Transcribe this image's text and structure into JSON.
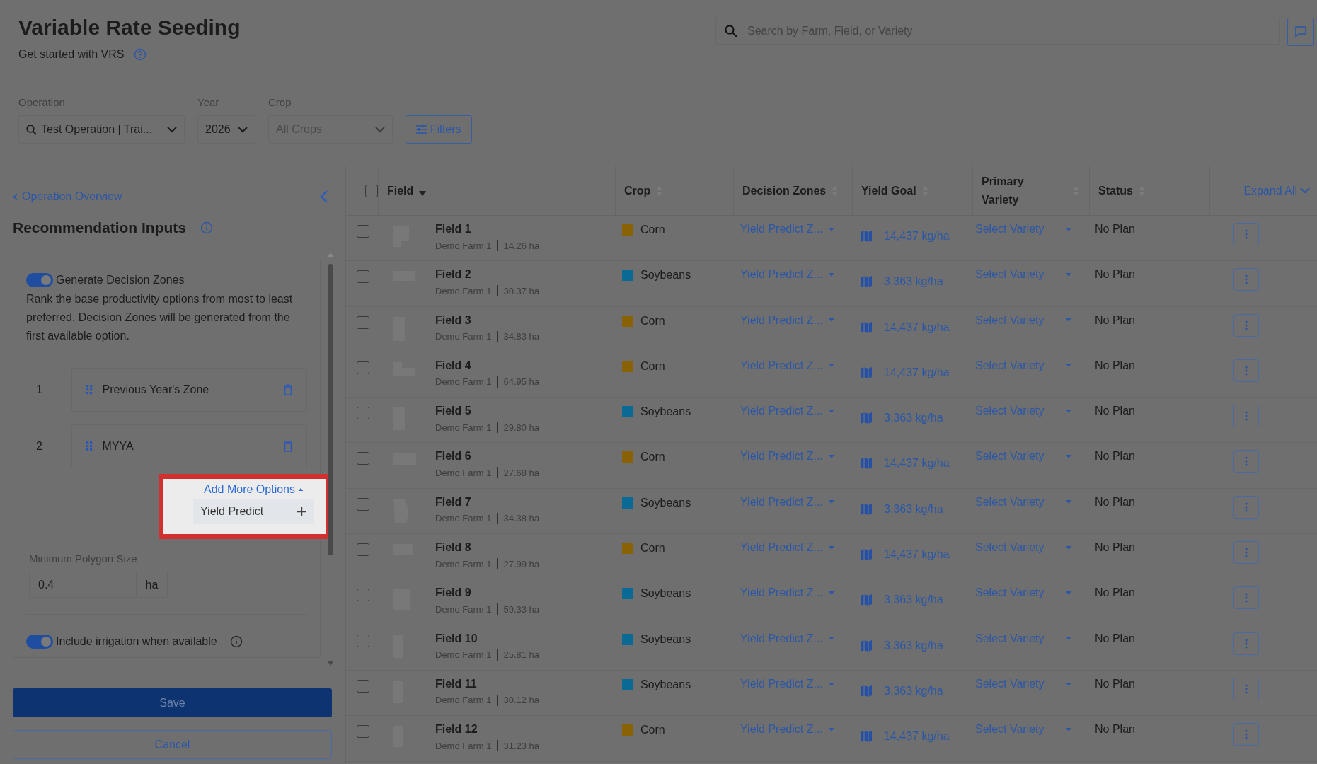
{
  "header": {
    "title": "Variable Rate Seeding",
    "help_link": "Get started with VRS"
  },
  "search": {
    "placeholder": "Search by Farm, Field, or Variety"
  },
  "filters": [
    {
      "label": "Operation",
      "value": "Test Operation | Trai...",
      "kind": "search-select",
      "placeholder": false
    },
    {
      "label": "Year",
      "value": "2026",
      "kind": "select",
      "placeholder": false
    },
    {
      "label": "Crop",
      "value": "All Crops",
      "kind": "select",
      "placeholder": true
    }
  ],
  "filters_button": "Filters",
  "sidebar": {
    "back_link": "Operation Overview",
    "heading": "Recommendation Inputs",
    "generate_zones": {
      "label": "Generate Decision Zones",
      "on": true,
      "description": "Rank the base productivity options from most to least preferred. Decision Zones will be generated from the first available option."
    },
    "options": [
      {
        "rank": "1",
        "name": "Previous Year's Zone"
      },
      {
        "rank": "2",
        "name": "MYYA"
      }
    ],
    "add_more": {
      "label": "Add More Options",
      "expanded": true,
      "items": [
        "Yield Predict"
      ]
    },
    "min_polygon": {
      "label": "Minimum Polygon Size",
      "value": "0.4",
      "unit": "ha"
    },
    "irrigation": {
      "label": "Include irrigation when available",
      "on": true
    },
    "save": "Save",
    "cancel": "Cancel"
  },
  "table": {
    "all_checked": false,
    "columns": [
      {
        "label": "Field",
        "sorted": true
      },
      {
        "label": "Crop",
        "sorted": false
      },
      {
        "label": "Decision Zones",
        "sorted": false
      },
      {
        "label": "Yield Goal",
        "sorted": false
      },
      {
        "label": "Primary Variety",
        "sorted": false
      },
      {
        "label": "Status",
        "sorted": false
      }
    ],
    "expand_all": "Expand All",
    "rows": [
      {
        "field": "Field 1",
        "farm": "Demo Farm 1",
        "area": "14.26 ha",
        "crop": "Corn",
        "color": "#8a6206",
        "zones": "Yield Predict Z...",
        "yield_goal": "14,437 kg/ha",
        "variety": "Select Variety",
        "status": "No Plan",
        "checked": false
      },
      {
        "field": "Field 2",
        "farm": "Demo Farm 1",
        "area": "30.37 ha",
        "crop": "Soybeans",
        "color": "#0a6a95",
        "zones": "Yield Predict Z...",
        "yield_goal": "3,363 kg/ha",
        "variety": "Select Variety",
        "status": "No Plan",
        "checked": false
      },
      {
        "field": "Field 3",
        "farm": "Demo Farm 1",
        "area": "34.83 ha",
        "crop": "Corn",
        "color": "#8a6206",
        "zones": "Yield Predict Z...",
        "yield_goal": "14,437 kg/ha",
        "variety": "Select Variety",
        "status": "No Plan",
        "checked": false
      },
      {
        "field": "Field 4",
        "farm": "Demo Farm 1",
        "area": "64.95 ha",
        "crop": "Corn",
        "color": "#8a6206",
        "zones": "Yield Predict Z...",
        "yield_goal": "14,437 kg/ha",
        "variety": "Select Variety",
        "status": "No Plan",
        "checked": false
      },
      {
        "field": "Field 5",
        "farm": "Demo Farm 1",
        "area": "29.80 ha",
        "crop": "Soybeans",
        "color": "#0a6a95",
        "zones": "Yield Predict Z...",
        "yield_goal": "3,363 kg/ha",
        "variety": "Select Variety",
        "status": "No Plan",
        "checked": false
      },
      {
        "field": "Field 6",
        "farm": "Demo Farm 1",
        "area": "27.68 ha",
        "crop": "Corn",
        "color": "#8a6206",
        "zones": "Yield Predict Z...",
        "yield_goal": "14,437 kg/ha",
        "variety": "Select Variety",
        "status": "No Plan",
        "checked": false
      },
      {
        "field": "Field 7",
        "farm": "Demo Farm 1",
        "area": "34.38 ha",
        "crop": "Soybeans",
        "color": "#0a6a95",
        "zones": "Yield Predict Z...",
        "yield_goal": "3,363 kg/ha",
        "variety": "Select Variety",
        "status": "No Plan",
        "checked": false
      },
      {
        "field": "Field 8",
        "farm": "Demo Farm 1",
        "area": "27.99 ha",
        "crop": "Corn",
        "color": "#8a6206",
        "zones": "Yield Predict Z...",
        "yield_goal": "14,437 kg/ha",
        "variety": "Select Variety",
        "status": "No Plan",
        "checked": false
      },
      {
        "field": "Field 9",
        "farm": "Demo Farm 1",
        "area": "59.33 ha",
        "crop": "Soybeans",
        "color": "#0a6a95",
        "zones": "Yield Predict Z...",
        "yield_goal": "3,363 kg/ha",
        "variety": "Select Variety",
        "status": "No Plan",
        "checked": false
      },
      {
        "field": "Field 10",
        "farm": "Demo Farm 1",
        "area": "25.81 ha",
        "crop": "Soybeans",
        "color": "#0a6a95",
        "zones": "Yield Predict Z...",
        "yield_goal": "3,363 kg/ha",
        "variety": "Select Variety",
        "status": "No Plan",
        "checked": false
      },
      {
        "field": "Field 11",
        "farm": "Demo Farm 1",
        "area": "30.12 ha",
        "crop": "Soybeans",
        "color": "#0a6a95",
        "zones": "Yield Predict Z...",
        "yield_goal": "3,363 kg/ha",
        "variety": "Select Variety",
        "status": "No Plan",
        "checked": false
      },
      {
        "field": "Field 12",
        "farm": "Demo Farm 1",
        "area": "31.23 ha",
        "crop": "Corn",
        "color": "#8a6206",
        "zones": "Yield Predict Z...",
        "yield_goal": "14,437 kg/ha",
        "variety": "Select Variety",
        "status": "No Plan",
        "checked": false
      }
    ]
  }
}
